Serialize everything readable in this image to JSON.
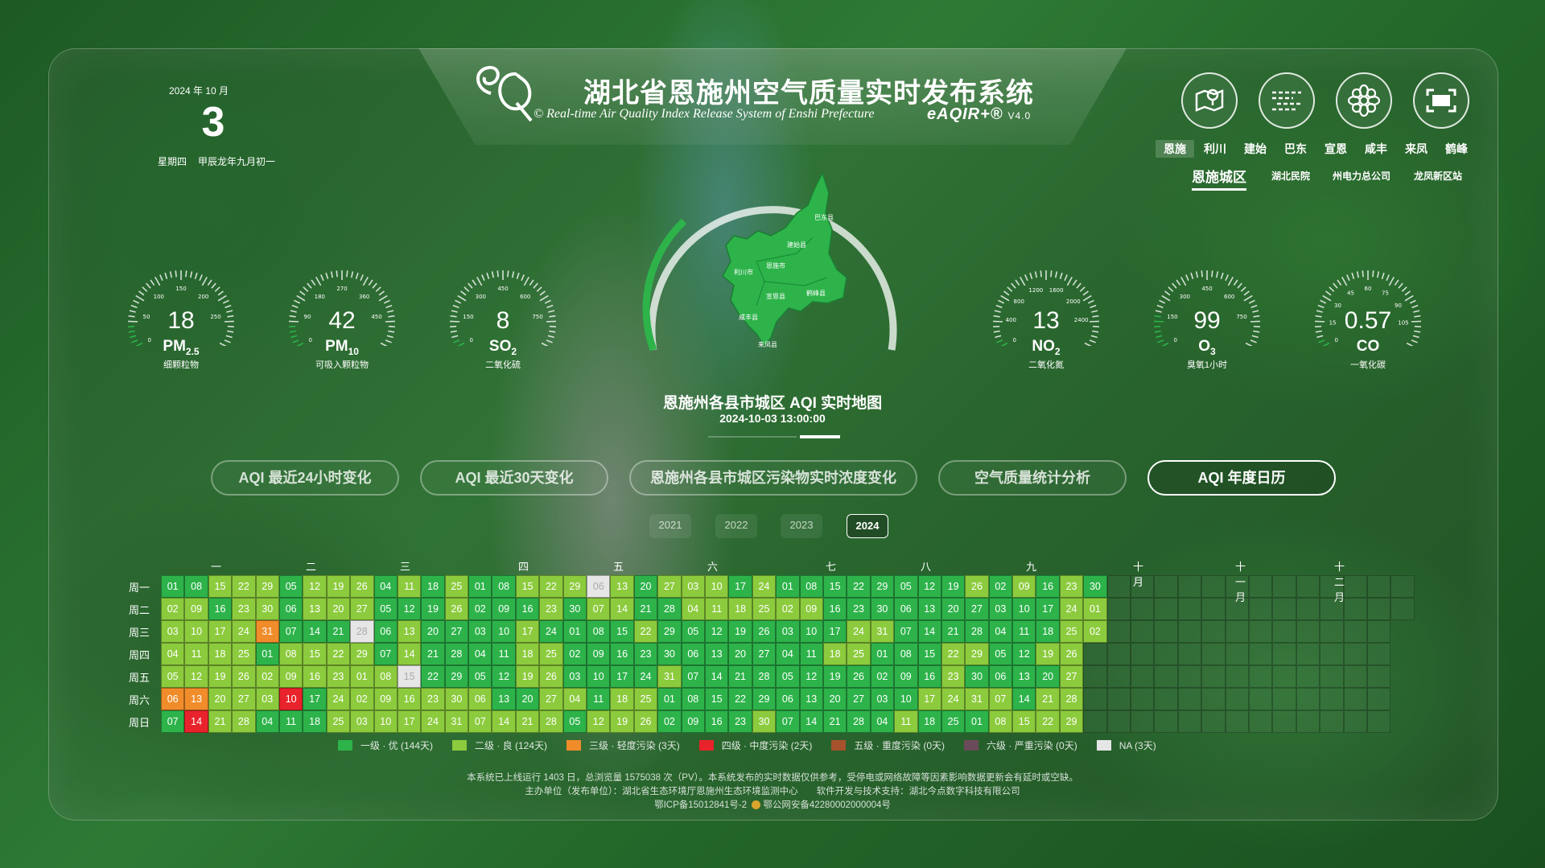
{
  "header": {
    "title_cn": "湖北省恩施州空气质量实时发布系统",
    "title_en": "© Real-time Air Quality Index Release System of Enshi Prefecture",
    "brand": "eAQIR+®",
    "version": "V4.0"
  },
  "date": {
    "year_month": "2024 年 10 月",
    "day": "3",
    "weekday": "星期四",
    "lunar": "甲辰龙年九月初一"
  },
  "top_icons": [
    "map-pin-icon",
    "haze-icon",
    "flower-icon",
    "fullscreen-icon"
  ],
  "cities": [
    "恩施",
    "利川",
    "建始",
    "巴东",
    "宣恩",
    "咸丰",
    "来凤",
    "鹤峰"
  ],
  "active_city": "恩施",
  "subtabs": [
    "恩施城区",
    "湖北民院",
    "州电力总公司",
    "龙凤新区站"
  ],
  "gauges_left": [
    {
      "value": "18",
      "name": "PM",
      "sub": "2.5",
      "cn": "细颗粒物",
      "ticks": [
        "50",
        "100",
        "150",
        "200",
        "250",
        "0"
      ],
      "level": 0.07
    },
    {
      "value": "42",
      "name": "PM",
      "sub": "10",
      "cn": "可吸入颗粒物",
      "ticks": [
        "90",
        "180",
        "270",
        "360",
        "450",
        "0"
      ],
      "level": 0.09
    },
    {
      "value": "8",
      "name": "SO",
      "sub": "2",
      "cn": "二氧化硫",
      "ticks": [
        "150",
        "300",
        "450",
        "600",
        "750",
        "0"
      ],
      "level": 0.01
    }
  ],
  "gauges_right": [
    {
      "value": "13",
      "name": "NO",
      "sub": "2",
      "cn": "二氧化氮",
      "ticks": [
        "400",
        "800",
        "1200",
        "1600",
        "2000",
        "2400",
        "0"
      ],
      "level": 0.01
    },
    {
      "value": "99",
      "name": "O",
      "sub": "3",
      "cn": "臭氧1小时",
      "ticks": [
        "150",
        "300",
        "450",
        "600",
        "750",
        "0"
      ],
      "level": 0.13
    },
    {
      "value": "0.57",
      "name": "CO",
      "sub": "",
      "cn": "一氧化碳",
      "ticks": [
        "15",
        "30",
        "45",
        "60",
        "75",
        "90",
        "105",
        "0"
      ],
      "level": 0.01
    }
  ],
  "map": {
    "caption": "恩施州各县市城区 AQI 实时地图",
    "datetime": "2024-10-03 13:00:00",
    "labels": [
      "巴东县",
      "建始县",
      "恩施市",
      "利川市",
      "宣恩县",
      "鹤峰县",
      "咸丰县",
      "来凤县"
    ]
  },
  "buttons": [
    "AQI 最近24小时变化",
    "AQI 最近30天变化",
    "恩施州各县市城区污染物实时浓度变化",
    "空气质量统计分析",
    "AQI 年度日历"
  ],
  "active_button": "AQI 年度日历",
  "years": [
    "2021",
    "2022",
    "2023",
    "2024"
  ],
  "active_year": "2024",
  "calendar": {
    "months": [
      "一月",
      "二月",
      "三月",
      "四月",
      "五月",
      "六月",
      "七月",
      "八月",
      "九月",
      "十月",
      "十一月",
      "十二月"
    ],
    "weekdays": [
      "周一",
      "周二",
      "周三",
      "周四",
      "周五",
      "周六",
      "周日"
    ],
    "level_colors": {
      "1": "#2db34a",
      "2": "#8ccb3d",
      "3": "#f08c2a",
      "4": "#e8232b",
      "na": "#e6e6e6"
    },
    "special_levels": {
      "2024-01-06": "3",
      "2024-01-13": "3",
      "2024-01-14": "4",
      "2024-01-31": "3",
      "2024-02-10": "4",
      "2024-02-28": "na",
      "2024-03-15": "na",
      "2024-05-06": "na"
    },
    "level1_days": [
      "2024-01-01",
      "2024-01-07",
      "2024-01-08",
      "2024-01-16",
      "2024-02-01",
      "2024-02-04",
      "2024-02-05",
      "2024-02-06",
      "2024-02-07",
      "2024-02-11",
      "2024-02-14",
      "2024-02-17",
      "2024-02-18",
      "2024-02-21",
      "2024-03-04",
      "2024-03-05",
      "2024-03-06",
      "2024-03-07",
      "2024-03-12",
      "2024-03-18",
      "2024-03-19",
      "2024-03-20",
      "2024-03-21",
      "2024-03-22",
      "2024-03-27",
      "2024-03-28",
      "2024-03-29",
      "2024-04-01",
      "2024-04-02",
      "2024-04-03",
      "2024-04-04",
      "2024-04-05",
      "2024-04-08",
      "2024-04-09",
      "2024-04-10",
      "2024-04-11",
      "2024-04-12",
      "2024-04-13",
      "2024-04-16",
      "2024-04-20",
      "2024-04-24",
      "2024-04-30",
      "2024-05-01",
      "2024-05-02",
      "2024-05-03",
      "2024-05-05",
      "2024-05-08",
      "2024-05-09",
      "2024-05-10",
      "2024-05-11",
      "2024-05-15",
      "2024-05-16",
      "2024-05-17",
      "2024-05-20",
      "2024-05-21",
      "2024-05-23",
      "2024-05-24",
      "2024-05-28",
      "2024-05-29",
      "2024-05-30",
      "2024-06-01",
      "2024-06-02",
      "2024-06-05",
      "2024-06-06",
      "2024-06-07",
      "2024-06-08",
      "2024-06-09",
      "2024-06-12",
      "2024-06-13",
      "2024-06-14",
      "2024-06-15",
      "2024-06-16",
      "2024-06-17",
      "2024-06-19",
      "2024-06-20",
      "2024-06-21",
      "2024-06-22",
      "2024-06-23",
      "2024-06-26",
      "2024-06-27",
      "2024-06-28",
      "2024-06-29",
      "2024-07-01",
      "2024-07-03",
      "2024-07-04",
      "2024-07-05",
      "2024-07-06",
      "2024-07-07",
      "2024-07-08",
      "2024-07-10",
      "2024-07-11",
      "2024-07-12",
      "2024-07-13",
      "2024-07-14",
      "2024-07-15",
      "2024-07-16",
      "2024-07-17",
      "2024-07-19",
      "2024-07-20",
      "2024-07-21",
      "2024-07-22",
      "2024-07-23",
      "2024-07-26",
      "2024-07-27",
      "2024-07-28",
      "2024-07-29",
      "2024-07-30",
      "2024-08-01",
      "2024-08-02",
      "2024-08-03",
      "2024-08-04",
      "2024-08-05",
      "2024-08-06",
      "2024-08-07",
      "2024-08-08",
      "2024-08-09",
      "2024-08-10",
      "2024-08-12",
      "2024-08-13",
      "2024-08-14",
      "2024-08-15",
      "2024-08-16",
      "2024-08-18",
      "2024-08-19",
      "2024-08-20",
      "2024-08-21",
      "2024-08-25",
      "2024-08-27",
      "2024-08-28",
      "2024-08-30",
      "2024-09-01",
      "2024-09-02",
      "2024-09-03",
      "2024-09-04",
      "2024-09-05",
      "2024-09-06",
      "2024-09-10",
      "2024-09-11",
      "2024-09-12",
      "2024-09-13",
      "2024-09-14",
      "2024-09-16",
      "2024-09-17",
      "2024-09-18",
      "2024-09-20",
      "2024-09-30"
    ],
    "last_date": "2024-10-02",
    "legend": [
      {
        "label": "一级 · 优 (144天)",
        "color": "#2db34a"
      },
      {
        "label": "二级 · 良 (124天)",
        "color": "#8ccb3d"
      },
      {
        "label": "三级 · 轻度污染 (3天)",
        "color": "#f08c2a"
      },
      {
        "label": "四级 · 中度污染 (2天)",
        "color": "#e8232b"
      },
      {
        "label": "五级 · 重度污染 (0天)",
        "color": "#a6532d"
      },
      {
        "label": "六级 · 严重污染 (0天)",
        "color": "#6b4a5a"
      },
      {
        "label": "NA (3天)",
        "color": "#e6e6e6"
      }
    ]
  },
  "footer": {
    "line1": "本系统已上线运行 1403 日，总浏览量 1575038 次（PV）。本系统发布的实时数据仅供参考，受停电或网络故障等因素影响数据更新会有延时或空缺。",
    "line2": "主办单位（发布单位）：湖北省生态环境厅恩施州生态环境监测中心　　软件开发与技术支持：湖北今点数字科技有限公司",
    "line3": "鄂ICP备15012841号-2",
    "line4": "鄂公网安备42280002000004号"
  }
}
